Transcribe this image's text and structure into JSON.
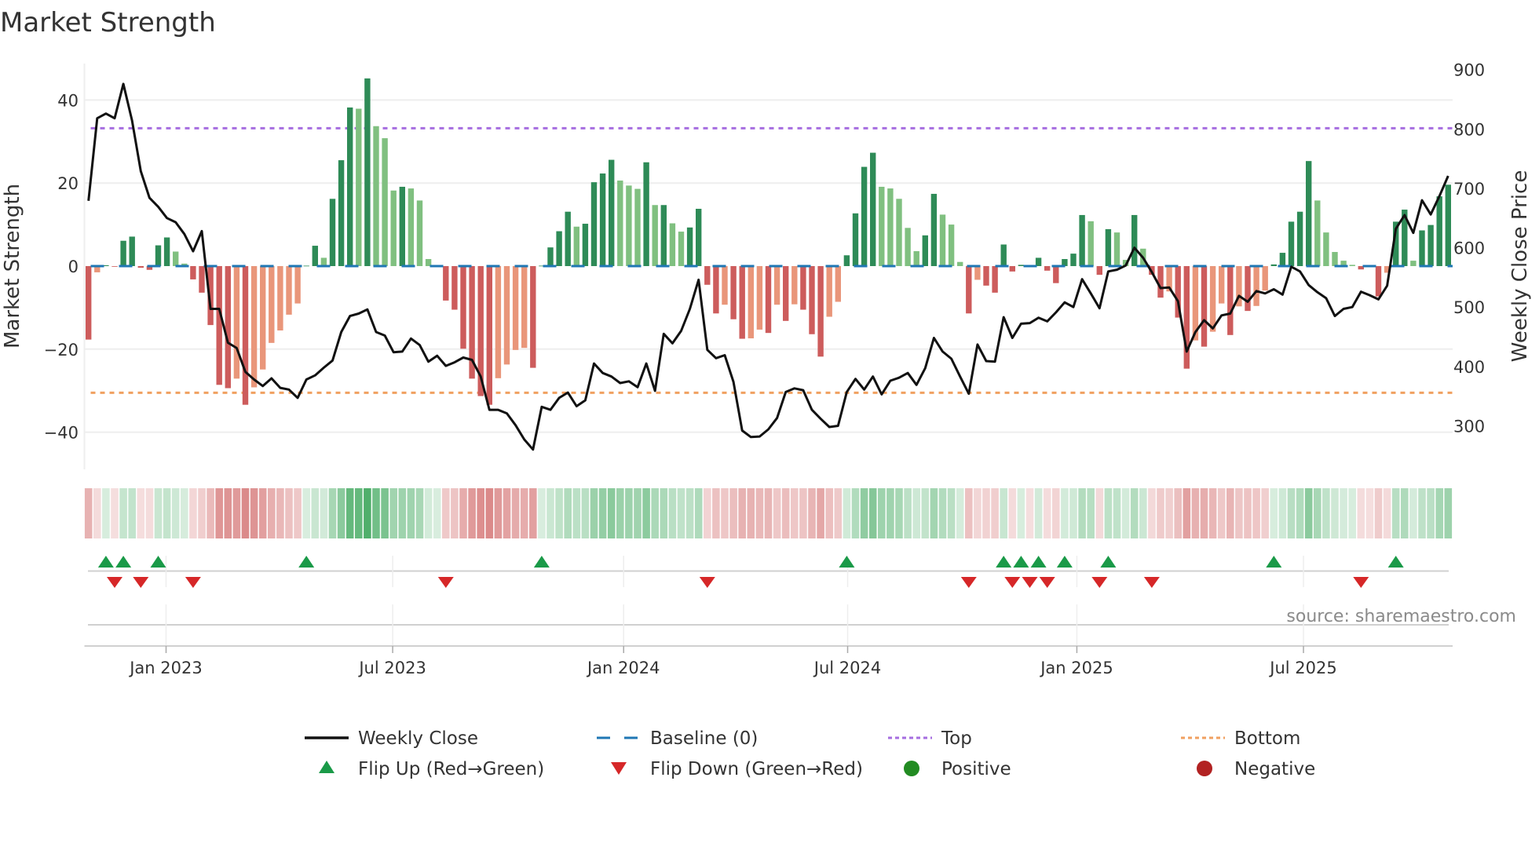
{
  "chart_data": {
    "type": "bar",
    "title": "Market Strength",
    "ylabel": "Market Strength",
    "y2label": "Weekly Close Price",
    "ylim": [
      -48,
      48
    ],
    "y2lim": [
      238,
      900
    ],
    "yticks": [
      40,
      20,
      0,
      -20,
      -40
    ],
    "ytick_labels": [
      "40",
      "20",
      "0",
      "−20",
      "−40"
    ],
    "y2ticks": [
      900,
      800,
      700,
      600,
      500,
      400,
      300
    ],
    "y2tick_labels": [
      "900",
      "800",
      "700",
      "600",
      "500",
      "400",
      "300"
    ],
    "x_unit": "week index",
    "xticks": [
      {
        "label": "Jan 2023",
        "week": 8.9
      },
      {
        "label": "Jul 2023",
        "week": 34.9
      },
      {
        "label": "Jan 2024",
        "week": 61.4
      },
      {
        "label": "Jul 2024",
        "week": 87.1
      },
      {
        "label": "Jan 2025",
        "week": 113.4
      },
      {
        "label": "Jul 2025",
        "week": 139.4
      }
    ],
    "top_level": 33.2,
    "bottom_level": -30.5,
    "baseline": 0,
    "strength": [
      -17.7,
      -1.5,
      0.2,
      -0.1,
      6.1,
      7.1,
      -0.4,
      -0.9,
      5.0,
      6.9,
      3.5,
      0.6,
      -3.2,
      -6.4,
      -14.2,
      -28.6,
      -29.4,
      -27.1,
      -33.4,
      -29.2,
      -24.9,
      -18.5,
      -15.5,
      -11.7,
      -9.0,
      0.1,
      4.9,
      2.0,
      16.2,
      25.5,
      38.2,
      37.9,
      45.2,
      33.7,
      30.8,
      18.2,
      19.1,
      18.7,
      15.8,
      1.7,
      0.1,
      -8.3,
      -10.5,
      -19.9,
      -27.1,
      -31.3,
      -33.4,
      -27.0,
      -23.7,
      -20.2,
      -19.7,
      -24.5,
      0.1,
      4.5,
      8.4,
      13.1,
      9.5,
      10.2,
      20.2,
      22.3,
      25.6,
      20.6,
      19.4,
      18.6,
      25.0,
      14.7,
      14.7,
      10.3,
      8.3,
      9.3,
      13.8,
      -4.5,
      -11.4,
      -9.3,
      -12.8,
      -17.5,
      -17.4,
      -15.3,
      -16.1,
      -9.3,
      -13.2,
      -9.2,
      -10.5,
      -16.4,
      -21.8,
      -12.2,
      -8.6,
      2.6,
      12.7,
      23.9,
      27.3,
      19.1,
      18.7,
      16.2,
      9.2,
      3.6,
      7.4,
      17.4,
      12.4,
      10.0,
      1.0,
      -11.4,
      -3.3,
      -4.7,
      -6.4,
      5.2,
      -1.3,
      0.3,
      -0.2,
      2.0,
      -1.1,
      -4.1,
      1.7,
      3.0,
      12.3,
      10.8,
      -2.1,
      8.9,
      8.1,
      1.5,
      12.3,
      4.2,
      -2.1,
      -7.6,
      -6.1,
      -12.4,
      -24.7,
      -17.9,
      -19.4,
      -15.8,
      -9.0,
      -16.6,
      -9.7,
      -10.8,
      -9.6,
      -5.9,
      0.4,
      3.2,
      10.7,
      13.1,
      25.3,
      15.8,
      8.1,
      3.4,
      1.3,
      0.3,
      -0.8,
      -0.1,
      -7.3,
      -1.6,
      10.7,
      13.6,
      1.3,
      8.6,
      9.9,
      16.8,
      19.6
    ],
    "weekly_close": [
      679,
      818,
      826,
      818,
      876,
      814,
      729,
      684,
      669,
      650,
      643,
      623,
      594,
      628,
      497,
      497,
      440,
      431,
      391,
      378,
      367,
      380,
      364,
      361,
      347,
      378,
      385,
      398,
      410,
      458,
      485,
      489,
      496,
      458,
      452,
      424,
      425,
      447,
      436,
      408,
      418,
      401,
      407,
      415,
      411,
      383,
      327,
      327,
      321,
      301,
      277,
      260,
      332,
      327,
      347,
      356,
      333,
      343,
      405,
      389,
      383,
      372,
      375,
      365,
      405,
      359,
      455,
      439,
      460,
      497,
      546,
      428,
      414,
      419,
      374,
      292,
      281,
      282,
      294,
      313,
      357,
      363,
      360,
      327,
      312,
      298,
      300,
      357,
      379,
      361,
      383,
      353,
      376,
      381,
      389,
      369,
      397,
      448,
      425,
      413,
      383,
      354,
      437,
      409,
      408,
      483,
      448,
      472,
      473,
      482,
      476,
      491,
      508,
      500,
      547,
      523,
      498,
      560,
      563,
      570,
      600,
      583,
      559,
      532,
      533,
      510,
      425,
      458,
      478,
      464,
      486,
      489,
      519,
      509,
      527,
      523,
      530,
      521,
      568,
      560,
      537,
      525,
      515,
      485,
      497,
      500,
      526,
      520,
      513,
      536,
      632,
      655,
      625,
      680,
      656,
      687,
      721
    ],
    "colors": {
      "pos_strong": "#2e8b57",
      "pos_weak": "#80c080",
      "neg_strong": "#cd5c5c",
      "neg_weak": "#e9967a",
      "baseline": "#1f77b4",
      "top": "#a66ee0",
      "bottom": "#f0a060",
      "close": "#111111",
      "flip_up": "#1a9a48",
      "flip_down": "#d62728",
      "positive": "#228b22",
      "negative": "#b22222",
      "heat_pos": "#3ca65a",
      "heat_neg": "#cd5c5c"
    },
    "legend": [
      {
        "label": "Weekly Close",
        "kind": "line"
      },
      {
        "label": "Baseline (0)",
        "kind": "dash"
      },
      {
        "label": "Top",
        "kind": "dot-top"
      },
      {
        "label": "Bottom",
        "kind": "dot-bottom"
      },
      {
        "label": "Flip Up (Red→Green)",
        "kind": "tri-up"
      },
      {
        "label": "Flip Down (Green→Red)",
        "kind": "tri-down"
      },
      {
        "label": "Positive",
        "kind": "dot-pos"
      },
      {
        "label": "Negative",
        "kind": "dot-neg"
      }
    ],
    "legend_placement": "bottom",
    "source": "source: sharemaestro.com"
  }
}
